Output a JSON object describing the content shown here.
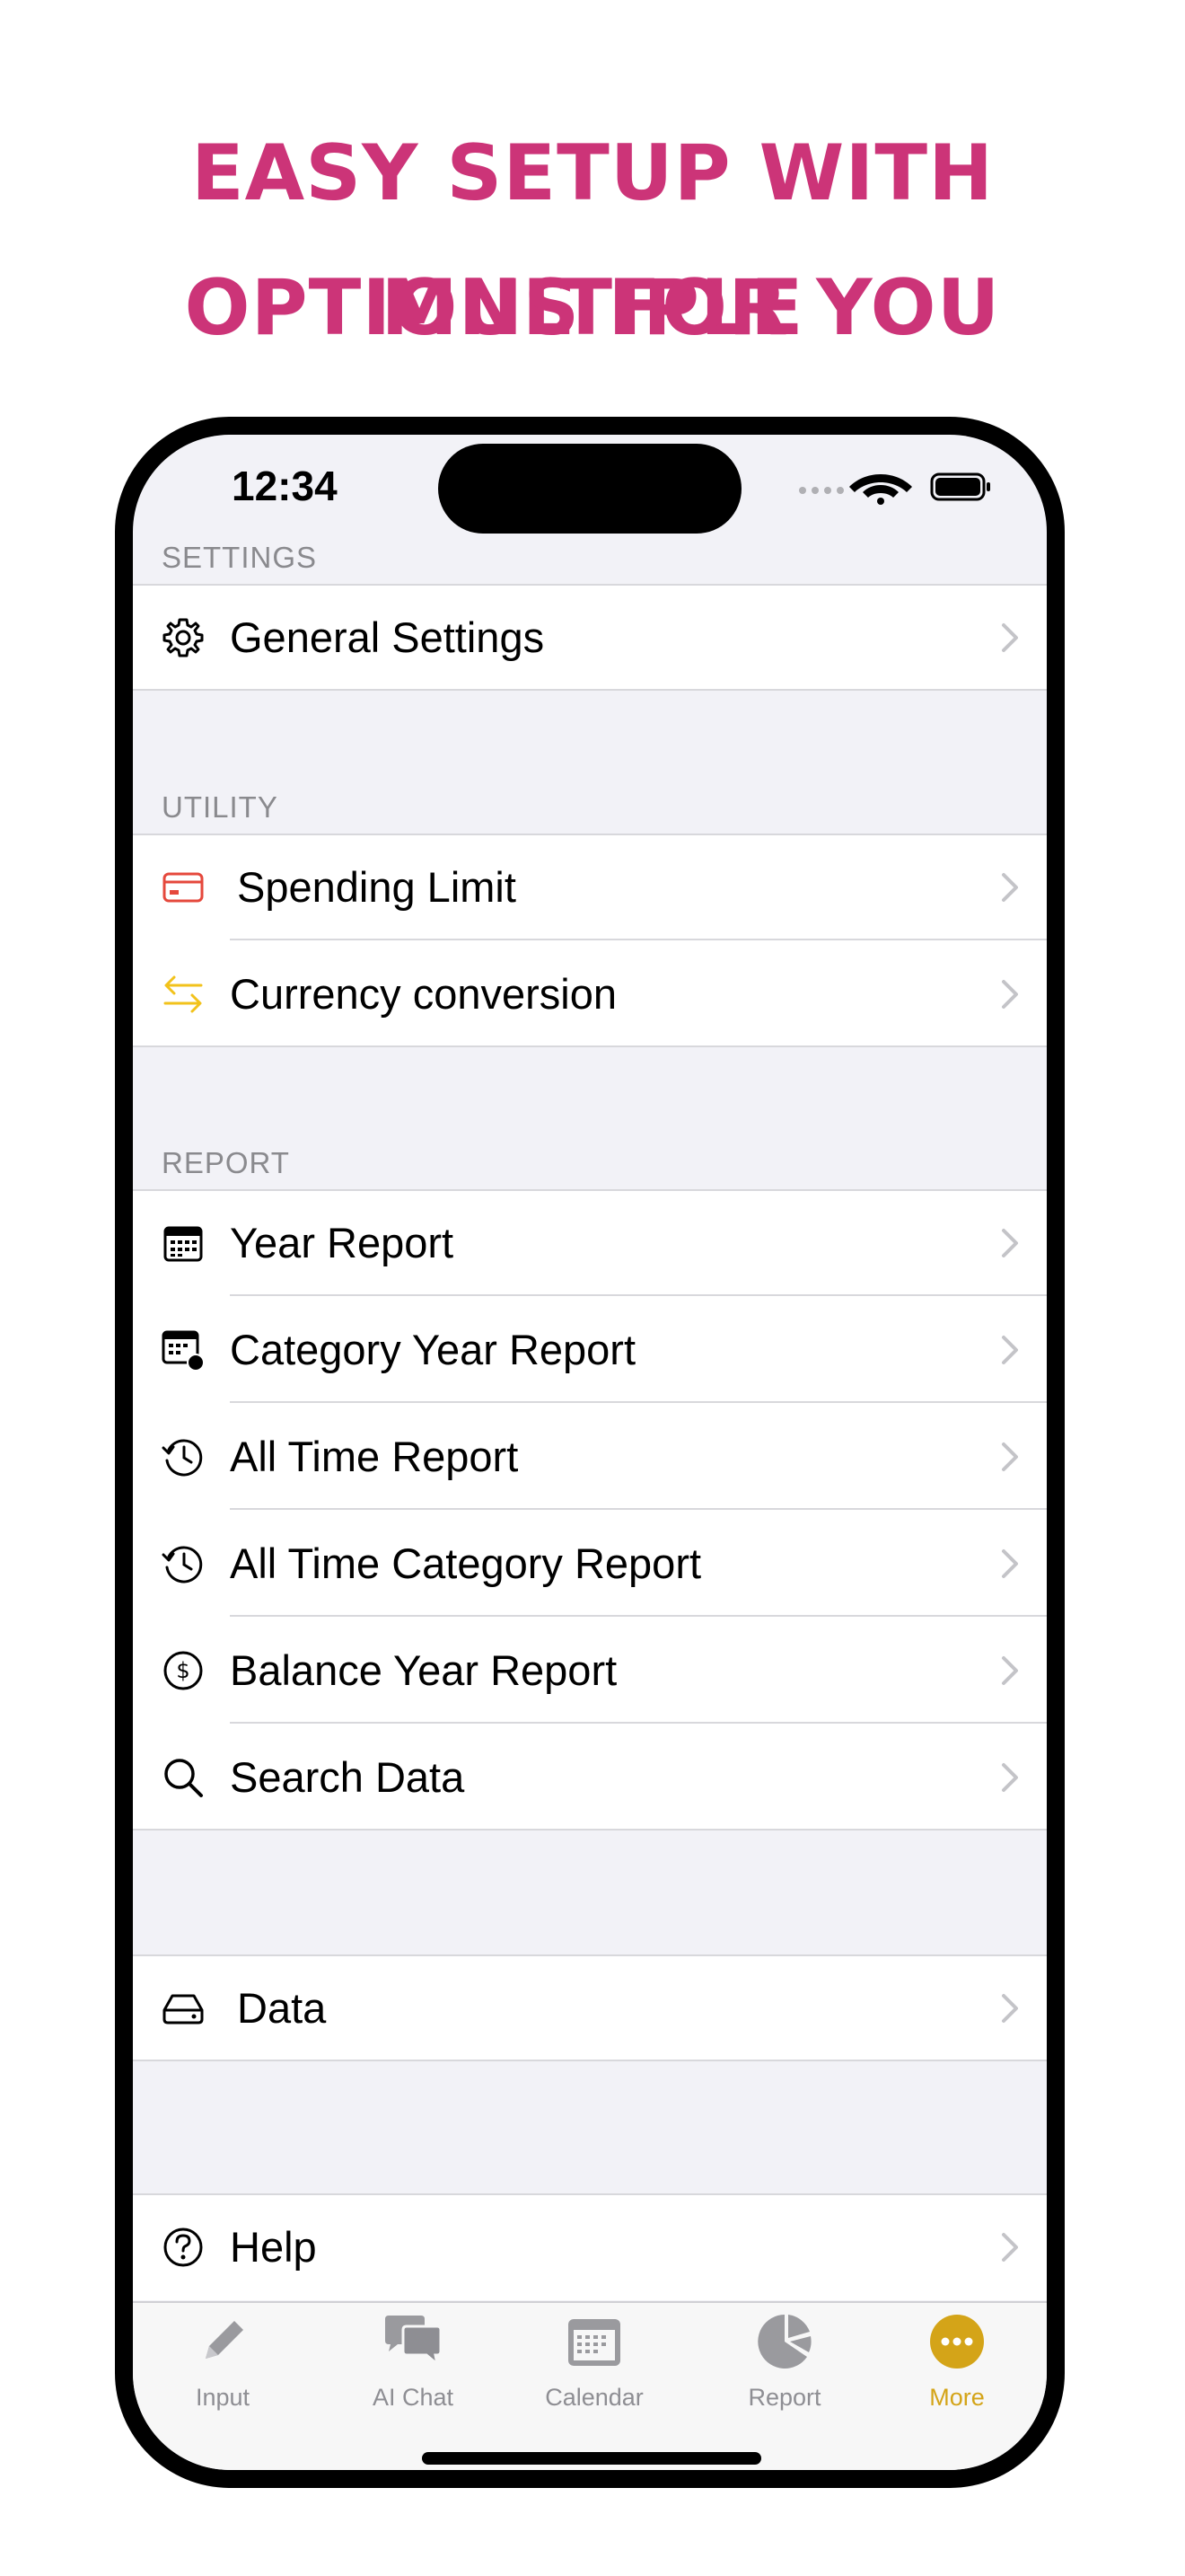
{
  "promo": {
    "line1": "EASY SETUP WITH MULTIPLE",
    "line2": "OPTIONS FOR YOU",
    "color": "#cc3478"
  },
  "status": {
    "time": "12:34"
  },
  "sections": {
    "settings": {
      "header": "SETTINGS",
      "items": [
        {
          "label": "General Settings",
          "icon": "gear-icon"
        }
      ]
    },
    "utility": {
      "header": "UTILITY",
      "items": [
        {
          "label": "Spending Limit",
          "icon": "credit-card-icon"
        },
        {
          "label": "Currency conversion",
          "icon": "arrows-exchange-icon"
        }
      ]
    },
    "report": {
      "header": "REPORT",
      "items": [
        {
          "label": "Year Report",
          "icon": "calendar-icon"
        },
        {
          "label": "Category Year Report",
          "icon": "calendar-badge-icon"
        },
        {
          "label": "All Time Report",
          "icon": "history-clock-icon"
        },
        {
          "label": "All Time Category Report",
          "icon": "history-clock-icon"
        },
        {
          "label": "Balance Year Report",
          "icon": "dollar-circle-icon"
        },
        {
          "label": "Search Data",
          "icon": "search-icon"
        }
      ]
    },
    "data": {
      "items": [
        {
          "label": "Data",
          "icon": "drive-icon"
        }
      ]
    },
    "help": {
      "items": [
        {
          "label": "Help",
          "icon": "question-circle-icon"
        }
      ]
    }
  },
  "tabs": [
    {
      "label": "Input",
      "icon": "pencil-icon"
    },
    {
      "label": "AI Chat",
      "icon": "chat-bubbles-icon"
    },
    {
      "label": "Calendar",
      "icon": "calendar-icon"
    },
    {
      "label": "Report",
      "icon": "pie-chart-icon"
    },
    {
      "label": "More",
      "icon": "more-icon",
      "active": true
    }
  ],
  "colors": {
    "accent": "#d4a418",
    "card_icon": "#e5483c",
    "exchange_icon": "#f2c21b",
    "section_header": "#8a8a8e",
    "background": "#f2f2f7"
  }
}
